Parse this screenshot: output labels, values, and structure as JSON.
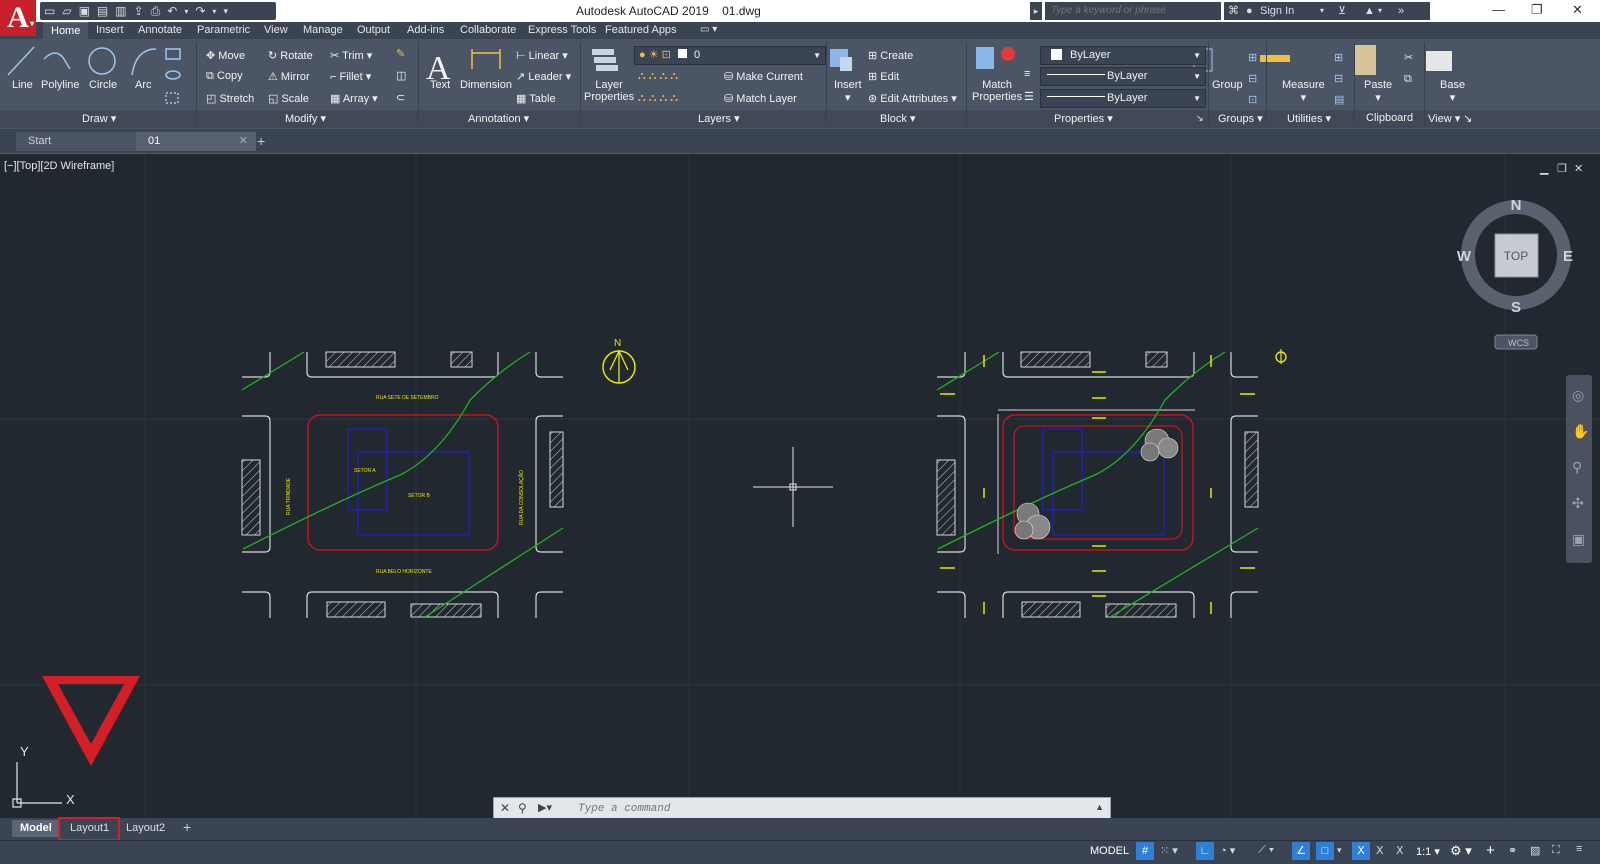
{
  "app": {
    "logo_letter": "A",
    "title": "Autodesk AutoCAD 2019",
    "file": "01.dwg",
    "search_placeholder": "Type a keyword or phrase",
    "sign_in": "Sign In"
  },
  "ribbon_tabs": [
    "Home",
    "Insert",
    "Annotate",
    "Parametric",
    "View",
    "Manage",
    "Output",
    "Add-ins",
    "Collaborate",
    "Express Tools",
    "Featured Apps"
  ],
  "draw": {
    "line": "Line",
    "polyline": "Polyline",
    "circle": "Circle",
    "arc": "Arc",
    "panel": "Draw"
  },
  "modify": {
    "move": "Move",
    "rotate": "Rotate",
    "trim": "Trim",
    "copy": "Copy",
    "mirror": "Mirror",
    "fillet": "Fillet",
    "stretch": "Stretch",
    "scale": "Scale",
    "array": "Array",
    "panel": "Modify"
  },
  "annotation": {
    "text": "Text",
    "dimension": "Dimension",
    "linear": "Linear",
    "leader": "Leader",
    "table": "Table",
    "panel": "Annotation"
  },
  "layers": {
    "layer_properties_1": "Layer",
    "layer_properties_2": "Properties",
    "current_layer": "0",
    "make_current": "Make Current",
    "match_layer": "Match Layer",
    "panel": "Layers"
  },
  "block": {
    "insert": "Insert",
    "create": "Create",
    "edit": "Edit",
    "edit_attributes": "Edit Attributes",
    "panel": "Block"
  },
  "properties": {
    "match_1": "Match",
    "match_2": "Properties",
    "color": "ByLayer",
    "linetype": "ByLayer",
    "lineweight": "ByLayer",
    "panel": "Properties"
  },
  "groups": {
    "group": "Group",
    "panel": "Groups"
  },
  "utilities": {
    "measure": "Measure",
    "panel": "Utilities"
  },
  "clipboard": {
    "paste": "Paste",
    "panel": "Clipboard"
  },
  "view": {
    "base": "Base",
    "panel": "View"
  },
  "doc_tabs": [
    "Start",
    "01"
  ],
  "viewport_label": "[−][Top][2D Wireframe]",
  "viewcube": {
    "n": "N",
    "s": "S",
    "e": "E",
    "w": "W",
    "top": "TOP",
    "wcs": "WCS"
  },
  "drawing": {
    "north": "N",
    "street_top": "RUA SETE DE SETEMBRO",
    "street_bottom": "RUA BELO HORIZONTE",
    "street_left": "RUA TRINDADE",
    "street_right": "RUA DA CONSOLAÇÃO",
    "sector_a": "SETOR A",
    "sector_b": "SETOR B"
  },
  "ucs": {
    "x": "X",
    "y": "Y"
  },
  "command": {
    "placeholder": "Type a command"
  },
  "layout_tabs": [
    "Model",
    "Layout1",
    "Layout2"
  ],
  "status": {
    "model": "MODEL",
    "scale": "1:1"
  },
  "colors": {
    "accent_red": "#d41f26",
    "cad_green": "#1fb51f",
    "cad_yellow": "#e8e800",
    "cad_red": "#c0161b",
    "cad_blue": "#1a1ab8"
  }
}
